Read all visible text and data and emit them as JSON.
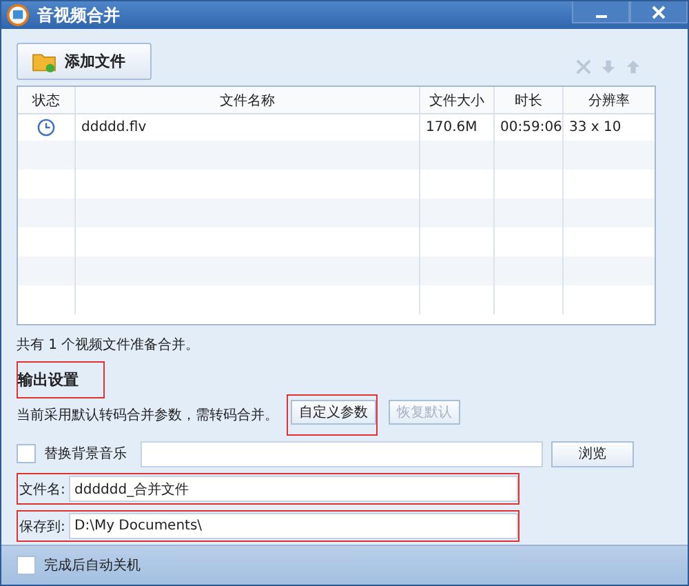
{
  "window": {
    "title": "音视频合并"
  },
  "toolbar": {
    "add_button": "添加文件",
    "actions": [
      {
        "kind": "delete",
        "disabled": true
      },
      {
        "kind": "down",
        "disabled": true
      },
      {
        "kind": "up",
        "disabled": true
      }
    ]
  },
  "table": {
    "columns": [
      "状态",
      "文件名称",
      "文件大小",
      "时长",
      "分辨率"
    ],
    "rows": [
      {
        "cells": [
          "",
          "ddddd.flv",
          "170.6M",
          "00:59:06",
          "33 x 10"
        ]
      }
    ]
  },
  "summary": "共有 1 个视频文件准备合并。",
  "output": {
    "heading": {
      "text": "输出设置",
      "highlighted": true
    },
    "note": "当前采用默认转码合并参数，需转码合并。",
    "buttons": [
      {
        "label": "自定义参数",
        "disabled": false,
        "highlighted": true
      },
      {
        "label": "恢复默认",
        "disabled": true,
        "highlighted": false
      }
    ],
    "music": {
      "label": "替换背景音乐",
      "checked": false,
      "browse": "浏览"
    },
    "fields": [
      {
        "label": "文件名:",
        "value": "dddddd_合并文件",
        "highlighted": true
      },
      {
        "label": "保存到:",
        "value": "D:\\My Documents\\",
        "highlighted": true
      }
    ]
  },
  "footer": {
    "label": "完成后自动关机",
    "checked": false
  }
}
